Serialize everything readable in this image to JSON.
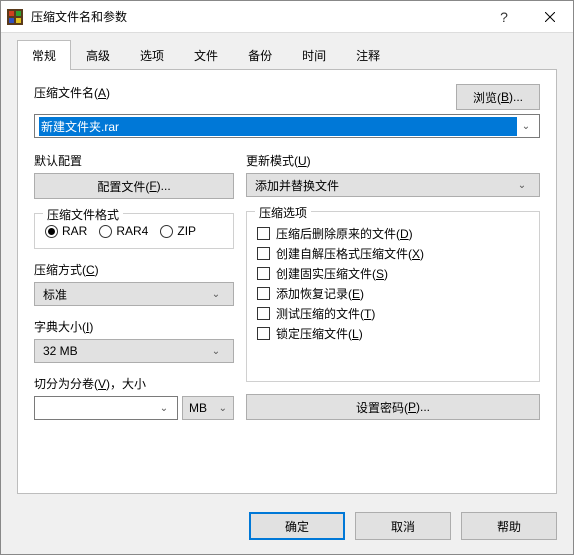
{
  "window": {
    "title": "压缩文件名和参数"
  },
  "tabs": {
    "list": [
      {
        "label": "常规"
      },
      {
        "label": "高级"
      },
      {
        "label": "选项"
      },
      {
        "label": "文件"
      },
      {
        "label": "备份"
      },
      {
        "label": "时间"
      },
      {
        "label": "注释"
      }
    ],
    "active_index": 0
  },
  "archive": {
    "name_label_pre": "压缩文件名(",
    "name_label_key": "A",
    "name_label_post": ")",
    "name_value": "新建文件夹.rar",
    "browse_pre": "浏览(",
    "browse_key": "B",
    "browse_post": ")..."
  },
  "default_profile": {
    "label": "默认配置",
    "button_pre": "配置文件(",
    "button_key": "F",
    "button_post": ")..."
  },
  "update_mode": {
    "label_pre": "更新模式(",
    "label_key": "U",
    "label_post": ")",
    "value": "添加并替换文件"
  },
  "format_group": {
    "legend": "压缩文件格式",
    "options": [
      {
        "label": "RAR",
        "checked": true
      },
      {
        "label": "RAR4",
        "checked": false
      },
      {
        "label": "ZIP",
        "checked": false
      }
    ]
  },
  "options_group": {
    "legend": "压缩选项",
    "items": [
      {
        "pre": "压缩后删除原来的文件(",
        "key": "D",
        "post": ")"
      },
      {
        "pre": "创建自解压格式压缩文件(",
        "key": "X",
        "post": ")"
      },
      {
        "pre": "创建固实压缩文件(",
        "key": "S",
        "post": ")"
      },
      {
        "pre": "添加恢复记录(",
        "key": "E",
        "post": ")"
      },
      {
        "pre": "测试压缩的文件(",
        "key": "T",
        "post": ")"
      },
      {
        "pre": "锁定压缩文件(",
        "key": "L",
        "post": ")"
      }
    ]
  },
  "method": {
    "label_pre": "压缩方式(",
    "label_key": "C",
    "label_post": ")",
    "value": "标准"
  },
  "dict": {
    "label_pre": "字典大小(",
    "label_key": "I",
    "label_post": ")",
    "value": "32 MB"
  },
  "split": {
    "label_pre": "切分为分卷(",
    "label_key": "V",
    "label_post": ")，大小",
    "value": "",
    "unit": "MB"
  },
  "password": {
    "button_pre": "设置密码(",
    "button_key": "P",
    "button_post": ")..."
  },
  "footer": {
    "ok": "确定",
    "cancel": "取消",
    "help": "帮助"
  }
}
